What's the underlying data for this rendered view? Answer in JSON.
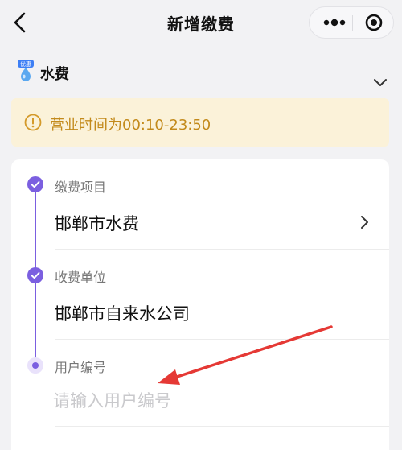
{
  "header": {
    "title": "新增缴费",
    "back_icon": "chevron-left-icon",
    "more_icon": "more-dots-icon",
    "close_icon": "target-close-icon"
  },
  "category": {
    "label": "水费",
    "badge": "优惠",
    "icon": "water-drop-icon",
    "expand_icon": "chevron-down-icon"
  },
  "notice": {
    "icon": "alert-circle-icon",
    "text": "营业时间为00:10-23:50",
    "color": "#c38a1b",
    "background": "#fbf2d9"
  },
  "form": {
    "accent_color": "#7b5fe0",
    "steps": [
      {
        "label": "缴费项目",
        "value": "邯郸市水费",
        "status": "done"
      },
      {
        "label": "收费单位",
        "value": "邯郸市自来水公司",
        "status": "done"
      },
      {
        "label": "用户编号",
        "placeholder": "请输入用户编号",
        "status": "current"
      }
    ]
  },
  "annotation": {
    "type": "arrow",
    "color": "#e53935"
  }
}
